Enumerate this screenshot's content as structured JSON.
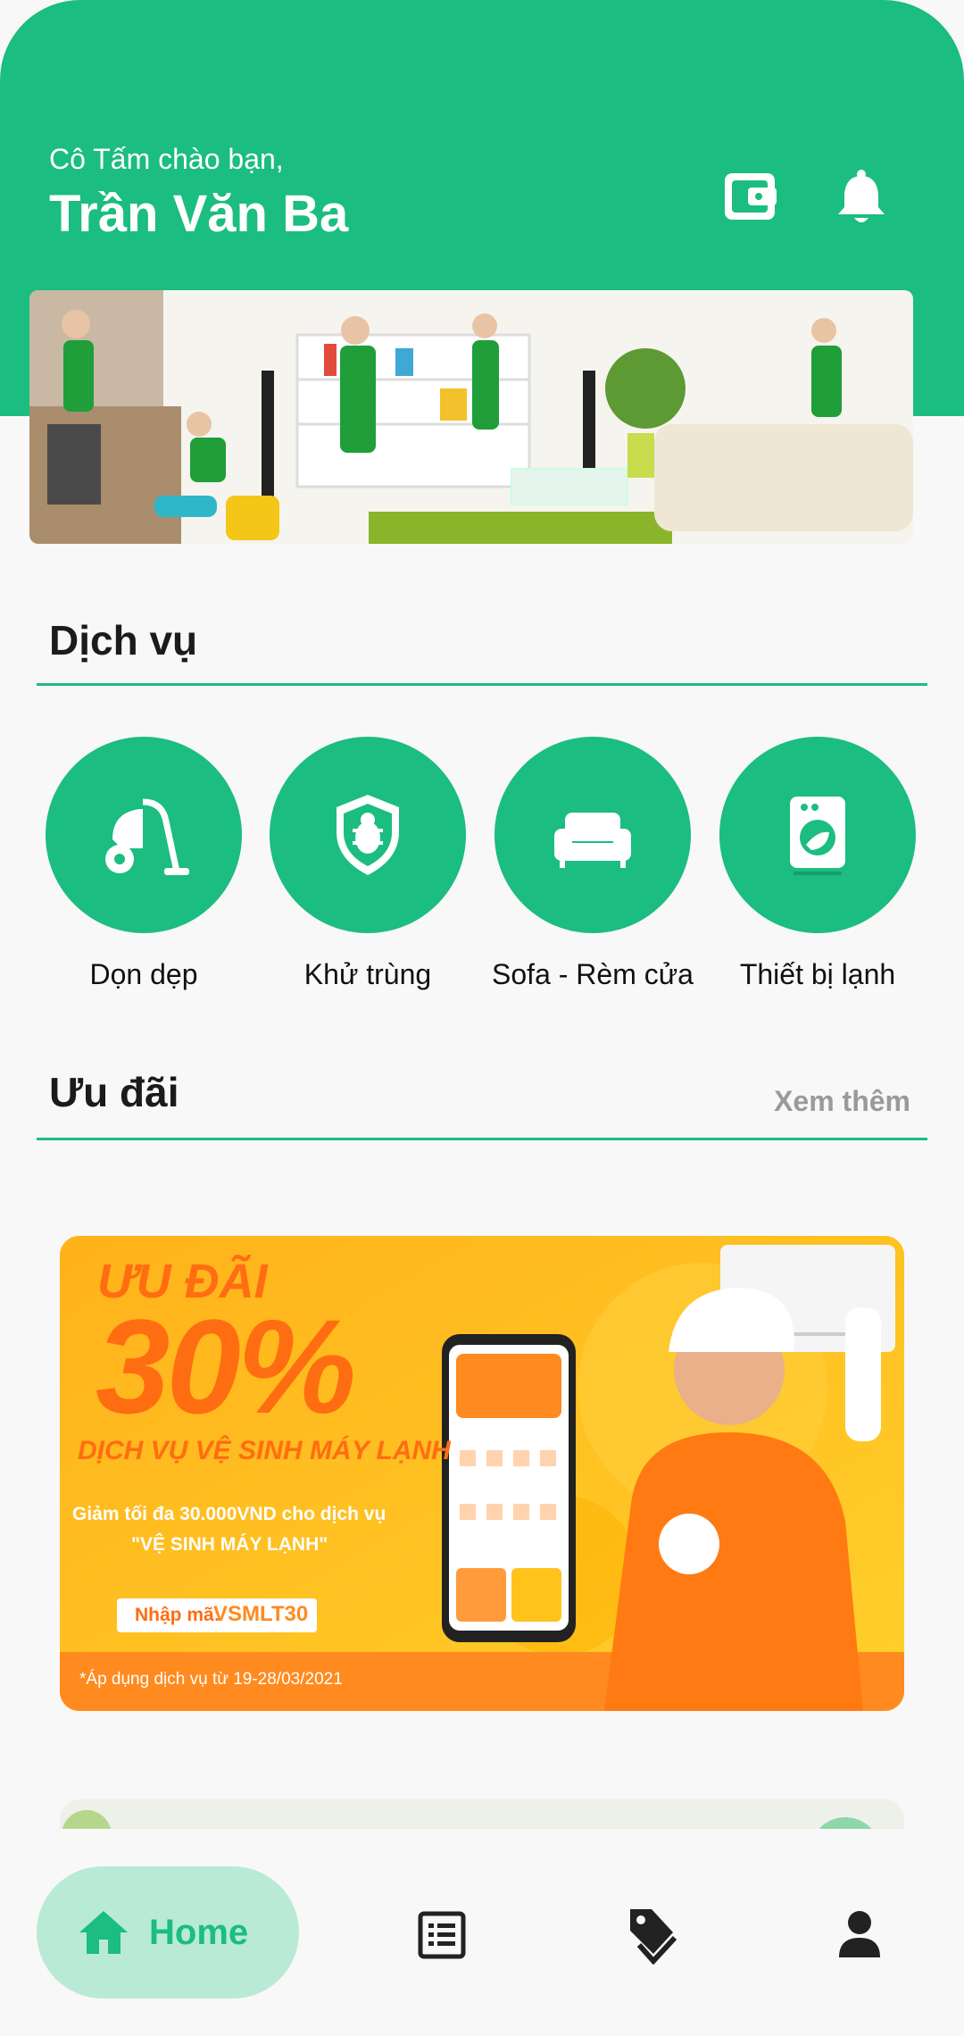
{
  "header": {
    "greeting": "Cô Tấm chào bạn,",
    "username": "Trần Văn Ba",
    "wallet_icon": "wallet-icon",
    "bell_icon": "bell-icon"
  },
  "services": {
    "title": "Dịch vụ",
    "items": [
      {
        "label": "Dọn dẹp",
        "icon": "vacuum-icon"
      },
      {
        "label": "Khử trùng",
        "icon": "disinfect-shield-icon"
      },
      {
        "label": "Sofa - Rèm cửa",
        "icon": "sofa-icon"
      },
      {
        "label": "Thiết bị lạnh",
        "icon": "washing-machine-icon"
      }
    ]
  },
  "offers": {
    "title": "Ưu đãi",
    "see_more": "Xem thêm",
    "banner": {
      "heading": "ƯU ĐÃI",
      "percent": "30%",
      "service": "DỊCH VỤ VỆ SINH MÁY LẠNH",
      "desc_line1": "Giảm tối đa 30.000VND cho dịch vụ",
      "desc_line2": "\"VỆ SINH MÁY LẠNH\"",
      "code_label": "Nhập mã:",
      "code": "VSMLT30",
      "footnote": "*Áp dụng dịch vụ từ 19-28/03/2021"
    }
  },
  "bottom_nav": {
    "home_label": "Home",
    "items": [
      "home-icon",
      "orders-list-icon",
      "tag-icon",
      "profile-icon"
    ]
  },
  "colors": {
    "primary": "#1bbd81",
    "primary_light": "#b9ead6",
    "banner_orange": "#ff8a1f",
    "banner_yellow": "#ffc31c"
  }
}
